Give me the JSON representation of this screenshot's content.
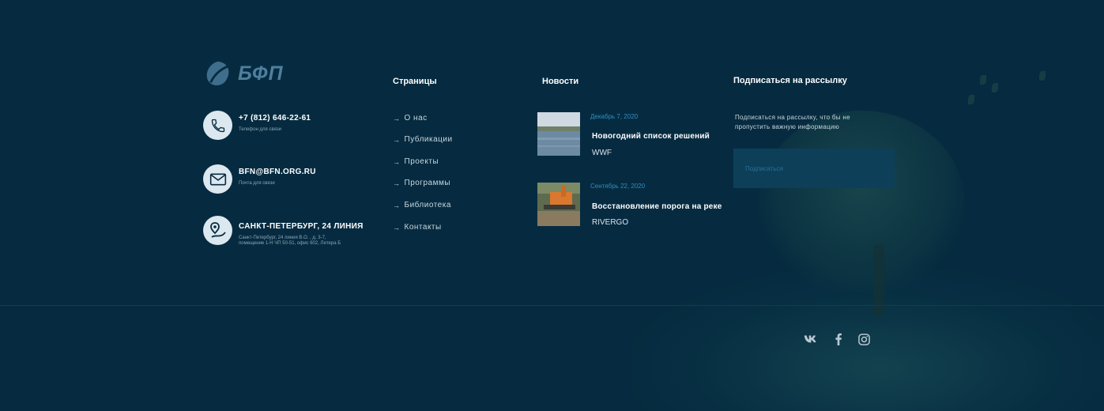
{
  "logo": {
    "text": "БФП"
  },
  "contacts": [
    {
      "icon": "phone-icon",
      "main": "+7 (812) 646-22-61",
      "sub": "Телефон для связи"
    },
    {
      "icon": "mail-icon",
      "main": "BFN@BFN.ORG.RU",
      "sub": "Почта для связи"
    },
    {
      "icon": "map-pin-icon",
      "main": "САНКТ-ПЕТЕРБУРГ, 24 ЛИНИЯ",
      "sub": "Санкт-Петербург, 24 линия В.О. , д. 3-7, помещение 1-Н ЧП 50-51, офис 602, Литера Б"
    }
  ],
  "pages": {
    "title": "Страницы",
    "items": [
      "О нас",
      "Публикации",
      "Проекты",
      "Программы",
      "Библиотека",
      "Контакты"
    ]
  },
  "news": {
    "title": "Новости",
    "items": [
      {
        "date": "Декабрь 7, 2020",
        "title": "Новогодний список решений",
        "tag": "WWF"
      },
      {
        "date": "Сентябрь 22, 2020",
        "title": "Восстановление порога на реке",
        "tag": "RIVERGO"
      }
    ]
  },
  "subscribe": {
    "title": "Подписаться на рассылку",
    "text": "Подписаться на рассылку, что бы не пропустить важную информацию",
    "button": "Подписаться"
  },
  "social": [
    "vk-icon",
    "facebook-icon",
    "instagram-icon"
  ],
  "colors": {
    "background": "#062b40",
    "accent": "#2e8fc0",
    "logo": "#4f7f9e"
  }
}
